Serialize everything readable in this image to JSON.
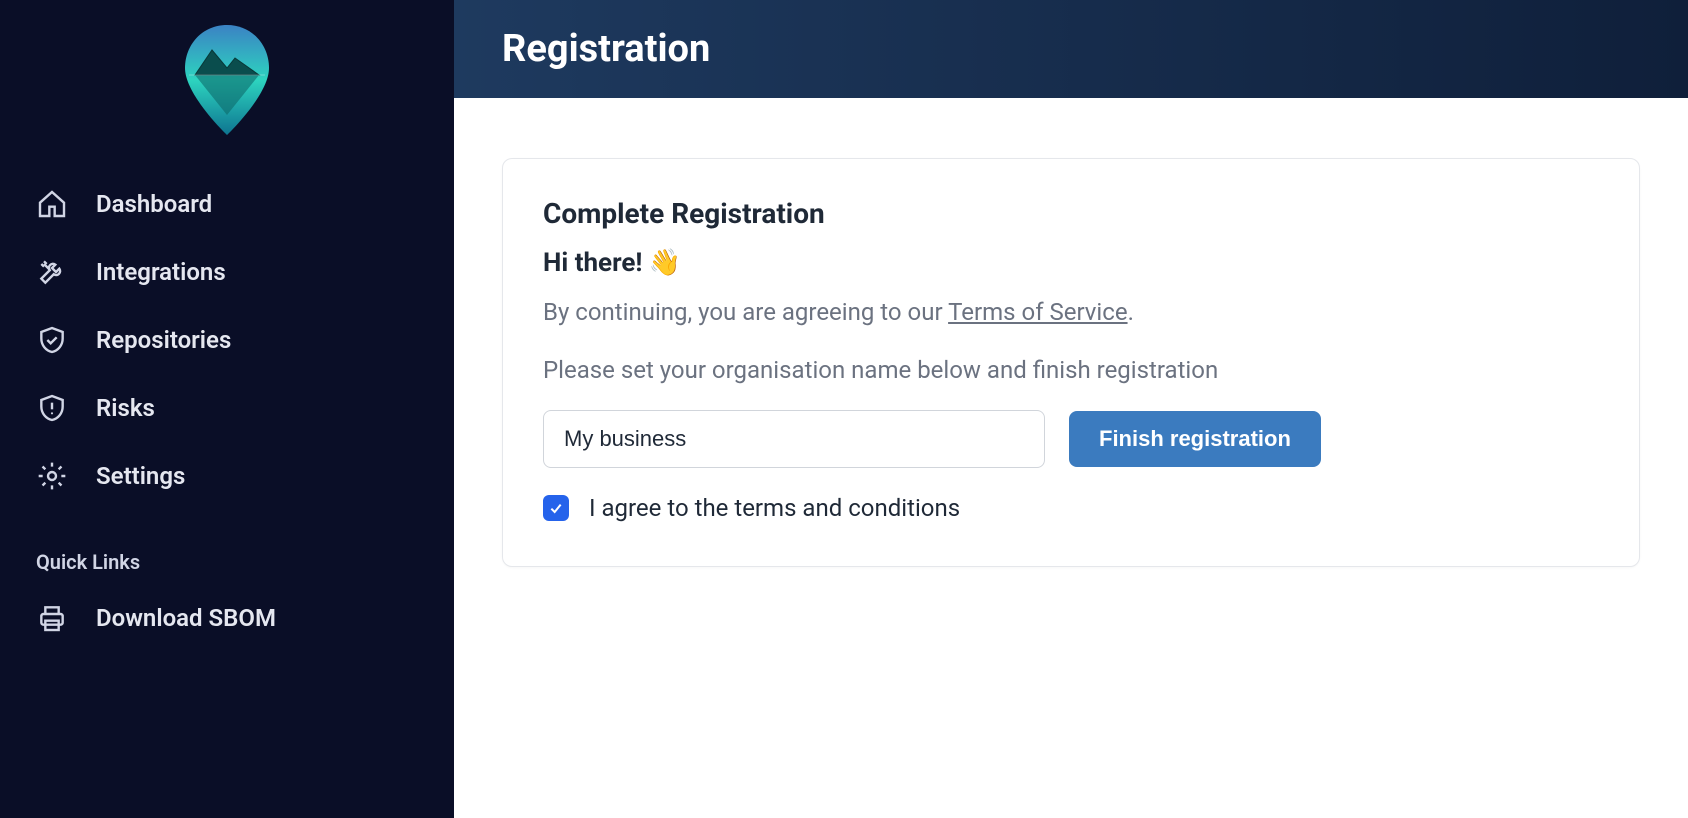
{
  "sidebar": {
    "items": [
      {
        "label": "Dashboard"
      },
      {
        "label": "Integrations"
      },
      {
        "label": "Repositories"
      },
      {
        "label": "Risks"
      },
      {
        "label": "Settings"
      }
    ],
    "quick_links_header": "Quick Links",
    "quick_links": [
      {
        "label": "Download SBOM"
      }
    ]
  },
  "header": {
    "title": "Registration"
  },
  "card": {
    "title": "Complete Registration",
    "greeting": "Hi there! 👋",
    "agreement_prefix": "By continuing, you are agreeing to our ",
    "agreement_link": "Terms of Service",
    "agreement_suffix": ".",
    "instruction": "Please set your organisation name below and finish registration",
    "org_input_value": "My business",
    "finish_button": "Finish registration",
    "checkbox_label": "I agree to the terms and conditions",
    "checkbox_checked": true
  }
}
